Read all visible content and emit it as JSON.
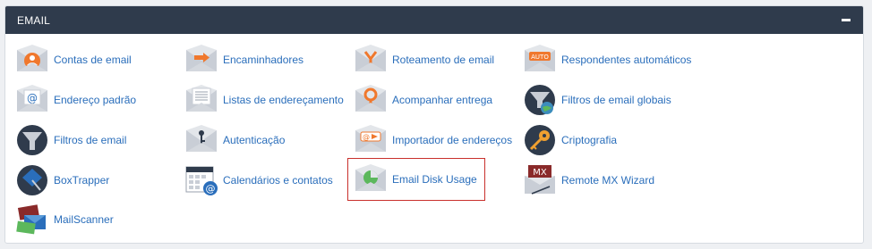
{
  "panel": {
    "title": "EMAIL"
  },
  "items": [
    {
      "label": "Contas de email",
      "icon": "email-accounts-icon",
      "badge": "person"
    },
    {
      "label": "Encaminhadores",
      "icon": "forwarders-icon",
      "badge": "arrow"
    },
    {
      "label": "Roteamento de email",
      "icon": "email-routing-icon",
      "badge": "fork"
    },
    {
      "label": "Respondentes automáticos",
      "icon": "autoresponders-icon",
      "badge": "AUTO"
    },
    {
      "label": "Endereço padrão",
      "icon": "default-address-icon",
      "badge": "at"
    },
    {
      "label": "Listas de endereçamento",
      "icon": "mailing-lists-icon",
      "badge": "list"
    },
    {
      "label": "Acompanhar entrega",
      "icon": "track-delivery-icon",
      "badge": "pin"
    },
    {
      "label": "Filtros de email globais",
      "icon": "global-email-filters-icon",
      "badge": "globe-funnel"
    },
    {
      "label": "Filtros de email",
      "icon": "email-filters-icon",
      "badge": "funnel"
    },
    {
      "label": "Autenticação",
      "icon": "authentication-icon",
      "badge": "key"
    },
    {
      "label": "Importador de endereços",
      "icon": "address-importer-icon",
      "badge": "at-arrow"
    },
    {
      "label": "Criptografia",
      "icon": "encryption-icon",
      "badge": "key-circle"
    },
    {
      "label": "BoxTrapper",
      "icon": "boxtrapper-icon",
      "badge": "trap"
    },
    {
      "label": "Calendários e contatos",
      "icon": "calendars-contacts-icon",
      "badge": "calendar"
    },
    {
      "label": "Email Disk Usage",
      "icon": "email-disk-usage-icon",
      "badge": "pie"
    },
    {
      "label": "Remote MX Wizard",
      "icon": "remote-mx-wizard-icon",
      "badge": "MX"
    },
    {
      "label": "MailScanner",
      "icon": "mailscanner-icon",
      "badge": "envelopes"
    }
  ],
  "colors": {
    "header_bg": "#2f3b4c",
    "link": "#2a6ebb",
    "accent_orange": "#f0782d",
    "highlight_border": "#c9302c"
  }
}
